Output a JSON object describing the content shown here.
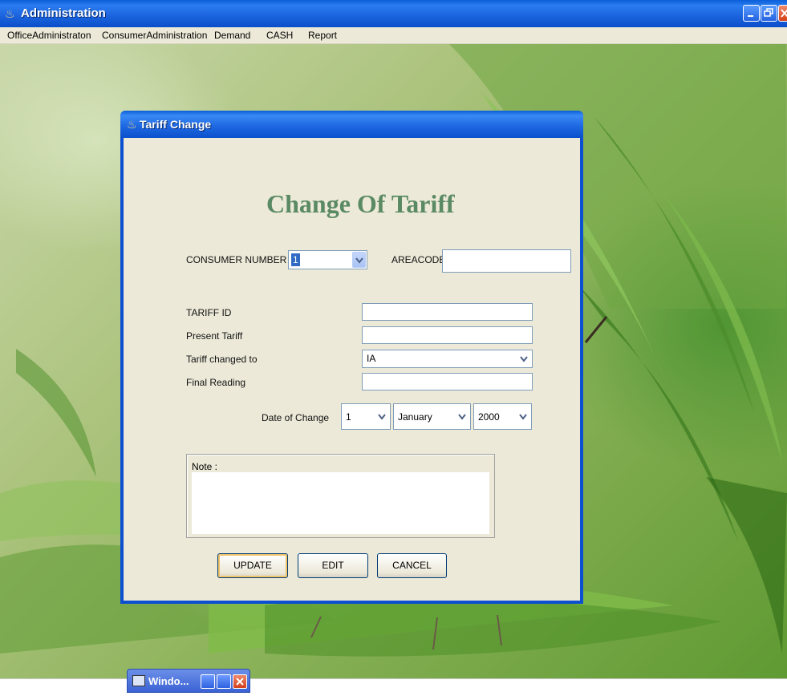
{
  "window": {
    "title": "Administration"
  },
  "menu": [
    "OfficeAdministraton",
    "ConsumerAdministration",
    "Demand",
    "CASH",
    "Report"
  ],
  "dialog": {
    "title": "Tariff Change",
    "heading": "Change Of Tariff",
    "consumer_number_label": "CONSUMER NUMBER",
    "consumer_number_value": "1",
    "areacode_label": "AREACODE",
    "areacode_value": "",
    "tariff_id_label": "TARIFF ID",
    "tariff_id_value": "",
    "present_tariff_label": "Present Tariff",
    "present_tariff_value": "",
    "tariff_changed_to_label": "Tariff changed to",
    "tariff_changed_to_value": "IA",
    "final_reading_label": "Final Reading",
    "final_reading_value": "",
    "date_label": "Date of Change",
    "date_day": "1",
    "date_month": "January",
    "date_year": "2000",
    "note_label": "Note :",
    "note_value": "",
    "buttons": {
      "update": "UPDATE",
      "edit": "EDIT",
      "cancel": "CANCEL"
    }
  },
  "taskbar": {
    "minimized_label": "Windo..."
  },
  "colors": {
    "heading": "#5a8a63",
    "titlebar": "#0a5ed8",
    "dialog_bg": "#ece9d8"
  }
}
